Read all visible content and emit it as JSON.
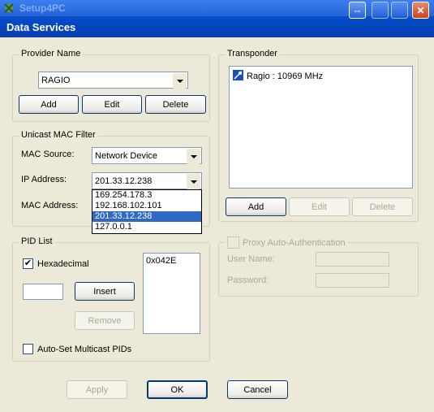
{
  "background_window": {
    "title": "Setup4PC"
  },
  "dialog": {
    "title": "Data Services"
  },
  "provider": {
    "legend": "Provider Name",
    "selected": "RAGIO",
    "add": "Add",
    "edit": "Edit",
    "delete": "Delete"
  },
  "unicast": {
    "legend": "Unicast MAC Filter",
    "mac_source_label": "MAC Source:",
    "mac_source_value": "Network Device",
    "ip_label": "IP Address:",
    "ip_value": "201.33.12.238",
    "mac_label": "MAC Address:",
    "ip_options": [
      "169.254.178.3",
      "192.168.102.101",
      "201.33.12.238",
      "127.0.0.1"
    ],
    "ip_selected_index": 2
  },
  "pid": {
    "legend": "PID List",
    "hexadecimal_label": "Hexadecimal",
    "hexadecimal_checked": true,
    "check_mark": "✔",
    "insert": "Insert",
    "remove": "Remove",
    "auto_set_label": "Auto-Set Multicast PIDs",
    "auto_set_checked": false,
    "items": [
      "0x042E"
    ]
  },
  "transponder": {
    "legend": "Transponder",
    "items": [
      "Ragio : 10969 MHz"
    ],
    "add": "Add",
    "edit": "Edit",
    "delete": "Delete"
  },
  "proxy": {
    "legend": "Proxy Auto-Authentication",
    "enabled": false,
    "user_label": "User Name:",
    "password_label": "Password:"
  },
  "footer": {
    "apply": "Apply",
    "ok": "OK",
    "cancel": "Cancel"
  },
  "icons": {
    "window_controls": [
      "restore-icon",
      "minimize-icon",
      "maximize-icon",
      "close-icon"
    ],
    "glyphs": {
      "restore": "⇔",
      "close": "✕"
    },
    "transponder_item": "satellite-icon"
  },
  "colors": {
    "title_blue": "#0549c4",
    "selection": "#316ac5",
    "face": "#ECE9D8"
  }
}
